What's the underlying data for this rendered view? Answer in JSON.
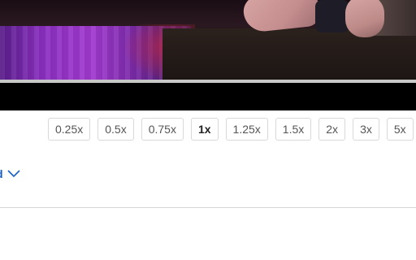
{
  "player": {
    "speed_options": [
      "0.25x",
      "0.5x",
      "0.75x",
      "1x",
      "1.25x",
      "1.5x",
      "2x",
      "3x",
      "5x"
    ],
    "selected_speed": "1x"
  },
  "more_link": {
    "label": "d",
    "icon": "chevron-down-icon",
    "color": "#1a5fc4"
  }
}
